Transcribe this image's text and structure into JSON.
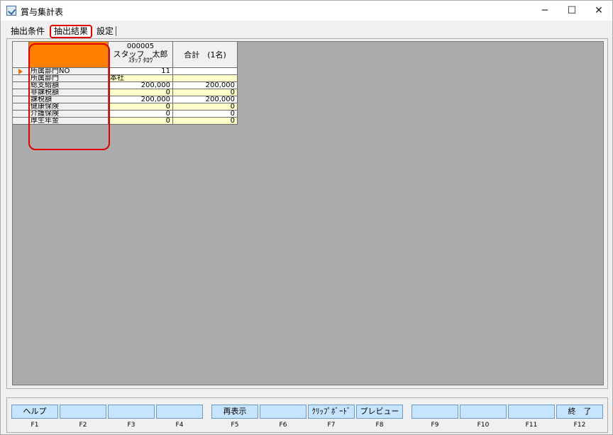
{
  "window": {
    "title": "賞与集計表",
    "minimize": "─",
    "maximize": "☐",
    "close": "✕"
  },
  "tabs": [
    {
      "label": "抽出条件"
    },
    {
      "label": "抽出結果"
    },
    {
      "label": "設定"
    }
  ],
  "grid": {
    "staff_code": "000005",
    "staff_name": "スタッフ　太郎",
    "staff_kana": "ｽﾀｯﾌ ﾀﾛｳ",
    "total_header": "合計　(1名)",
    "rows": [
      {
        "label": "所属部門NO",
        "v1": "11",
        "v2": "",
        "style": "white"
      },
      {
        "label": "所属部門",
        "v1": "本社",
        "v2": "",
        "style": "yellow"
      },
      {
        "label": "総支給額",
        "v1": "200,000",
        "v2": "200,000",
        "style": "white"
      },
      {
        "label": "非課税額",
        "v1": "0",
        "v2": "0",
        "style": "yellow"
      },
      {
        "label": "課税額",
        "v1": "200,000",
        "v2": "200,000",
        "style": "white"
      },
      {
        "label": "健康保険",
        "v1": "0",
        "v2": "0",
        "style": "yellow"
      },
      {
        "label": "介護保険",
        "v1": "0",
        "v2": "0",
        "style": "white"
      },
      {
        "label": "厚生年金",
        "v1": "0",
        "v2": "0",
        "style": "yellow"
      }
    ]
  },
  "function_keys": [
    {
      "label": "ヘルプ",
      "key": "F1"
    },
    {
      "label": "",
      "key": "F2"
    },
    {
      "label": "",
      "key": "F3"
    },
    {
      "label": "",
      "key": "F4"
    },
    {
      "label": "再表示",
      "key": "F5"
    },
    {
      "label": "",
      "key": "F6"
    },
    {
      "label": "ｸﾘｯﾌﾟﾎﾞｰﾄﾞ",
      "key": "F7"
    },
    {
      "label": "プレビュー",
      "key": "F8"
    },
    {
      "label": "",
      "key": "F9"
    },
    {
      "label": "",
      "key": "F10"
    },
    {
      "label": "",
      "key": "F11"
    },
    {
      "label": "終　了",
      "key": "F12"
    }
  ],
  "colors": {
    "label_header": "#ff7f00",
    "highlight": "#e00000",
    "row_yellow": "#ffffcc",
    "fkey_bg": "#c7e4ff"
  }
}
